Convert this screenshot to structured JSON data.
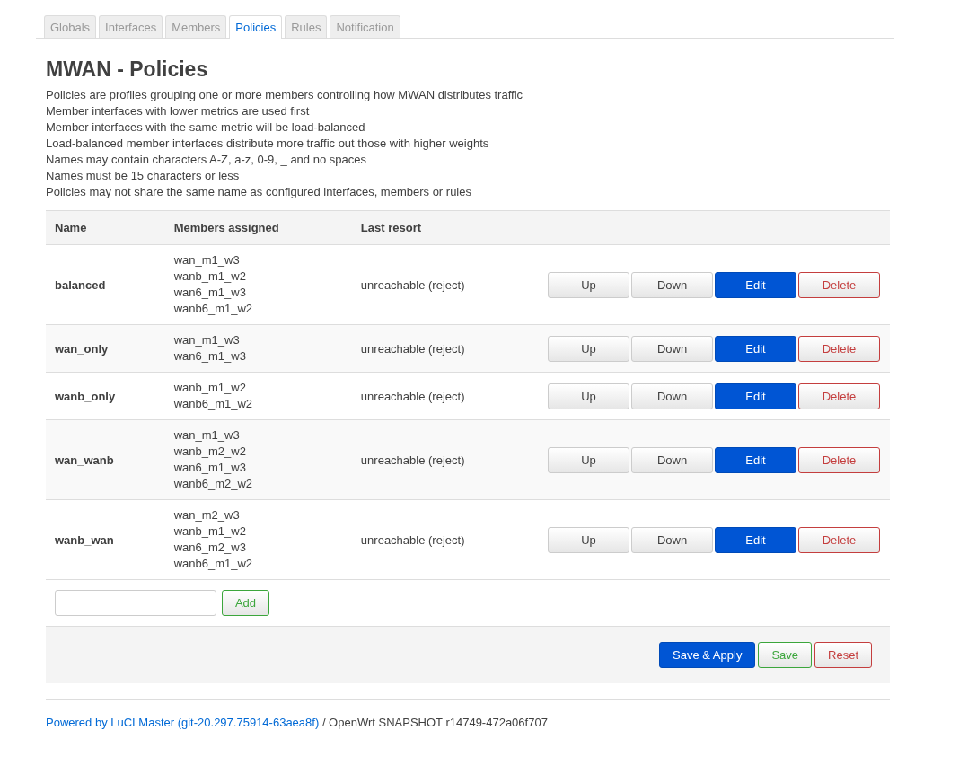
{
  "tabs": [
    {
      "label": "Globals",
      "selected": false
    },
    {
      "label": "Interfaces",
      "selected": false
    },
    {
      "label": "Members",
      "selected": false
    },
    {
      "label": "Policies",
      "selected": true
    },
    {
      "label": "Rules",
      "selected": false
    },
    {
      "label": "Notification",
      "selected": false
    }
  ],
  "title": "MWAN - Policies",
  "description": [
    "Policies are profiles grouping one or more members controlling how MWAN distributes traffic",
    "Member interfaces with lower metrics are used first",
    "Member interfaces with the same metric will be load-balanced",
    "Load-balanced member interfaces distribute more traffic out those with higher weights",
    "Names may contain characters A-Z, a-z, 0-9, _ and no spaces",
    "Names must be 15 characters or less",
    "Policies may not share the same name as configured interfaces, members or rules"
  ],
  "table": {
    "columns": [
      "Name",
      "Members assigned",
      "Last resort"
    ],
    "rows": [
      {
        "name": "balanced",
        "members": [
          "wan_m1_w3",
          "wanb_m1_w2",
          "wan6_m1_w3",
          "wanb6_m1_w2"
        ],
        "last_resort": "unreachable (reject)",
        "actions": [
          {
            "label": "Up",
            "kind": "plain"
          },
          {
            "label": "Down",
            "kind": "plain"
          },
          {
            "label": "Edit",
            "kind": "primary"
          },
          {
            "label": "Delete",
            "kind": "negative"
          }
        ]
      },
      {
        "name": "wan_only",
        "members": [
          "wan_m1_w3",
          "wan6_m1_w3"
        ],
        "last_resort": "unreachable (reject)",
        "actions": [
          {
            "label": "Up",
            "kind": "plain"
          },
          {
            "label": "Down",
            "kind": "plain"
          },
          {
            "label": "Edit",
            "kind": "primary"
          },
          {
            "label": "Delete",
            "kind": "negative"
          }
        ]
      },
      {
        "name": "wanb_only",
        "members": [
          "wanb_m1_w2",
          "wanb6_m1_w2"
        ],
        "last_resort": "unreachable (reject)",
        "actions": [
          {
            "label": "Up",
            "kind": "plain"
          },
          {
            "label": "Down",
            "kind": "plain"
          },
          {
            "label": "Edit",
            "kind": "primary"
          },
          {
            "label": "Delete",
            "kind": "negative"
          }
        ]
      },
      {
        "name": "wan_wanb",
        "members": [
          "wan_m1_w3",
          "wanb_m2_w2",
          "wan6_m1_w3",
          "wanb6_m2_w2"
        ],
        "last_resort": "unreachable (reject)",
        "actions": [
          {
            "label": "Up",
            "kind": "plain"
          },
          {
            "label": "Down",
            "kind": "plain"
          },
          {
            "label": "Edit",
            "kind": "primary"
          },
          {
            "label": "Delete",
            "kind": "negative"
          }
        ]
      },
      {
        "name": "wanb_wan",
        "members": [
          "wan_m2_w3",
          "wanb_m1_w2",
          "wan6_m2_w3",
          "wanb6_m1_w2"
        ],
        "last_resort": "unreachable (reject)",
        "actions": [
          {
            "label": "Up",
            "kind": "plain"
          },
          {
            "label": "Down",
            "kind": "plain"
          },
          {
            "label": "Edit",
            "kind": "primary"
          },
          {
            "label": "Delete",
            "kind": "negative"
          }
        ]
      }
    ]
  },
  "add": {
    "button": {
      "label": "Add",
      "kind": "positive"
    }
  },
  "page_actions": [
    {
      "label": "Save & Apply",
      "kind": "primary"
    },
    {
      "label": "Save",
      "kind": "positive"
    },
    {
      "label": "Reset",
      "kind": "negative"
    }
  ],
  "footer": {
    "link": "Powered by LuCI Master (git-20.297.75914-63aea8f)",
    "text": "/ OpenWrt SNAPSHOT r14749-472a06f707"
  }
}
